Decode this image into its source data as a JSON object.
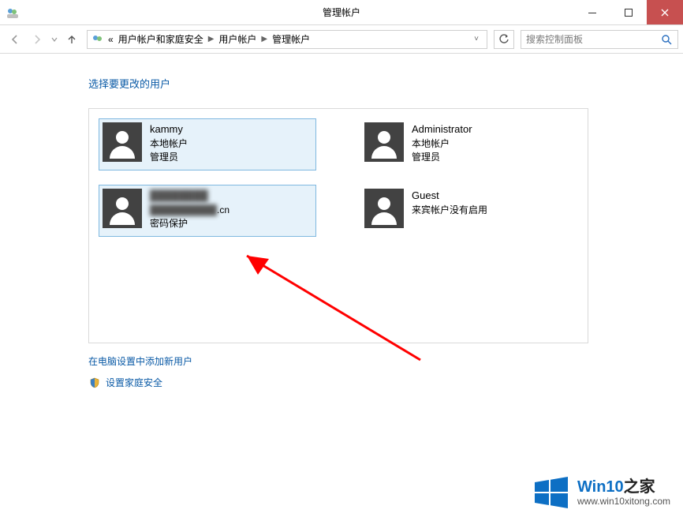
{
  "window": {
    "title": "管理帐户"
  },
  "breadcrumb": {
    "prefix": "«",
    "items": [
      "用户帐户和家庭安全",
      "用户帐户",
      "管理帐户"
    ]
  },
  "search": {
    "placeholder": "搜索控制面板"
  },
  "heading": "选择要更改的用户",
  "accounts": [
    {
      "name": "kammy",
      "line1": "本地帐户",
      "line2": "管理员",
      "selected": true
    },
    {
      "name": "Administrator",
      "line1": "本地帐户",
      "line2": "管理员",
      "selected": false
    },
    {
      "name": "",
      "line1_blur": ".cn",
      "line2": "密码保护",
      "selected": true
    },
    {
      "name": "Guest",
      "line1": "来宾帐户没有启用",
      "line2": "",
      "selected": false
    }
  ],
  "links": {
    "add_user": "在电脑设置中添加新用户",
    "family_safety": "设置家庭安全"
  },
  "watermark": {
    "title_a": "Win10",
    "title_b": "之家",
    "url": "www.win10xitong.com"
  }
}
